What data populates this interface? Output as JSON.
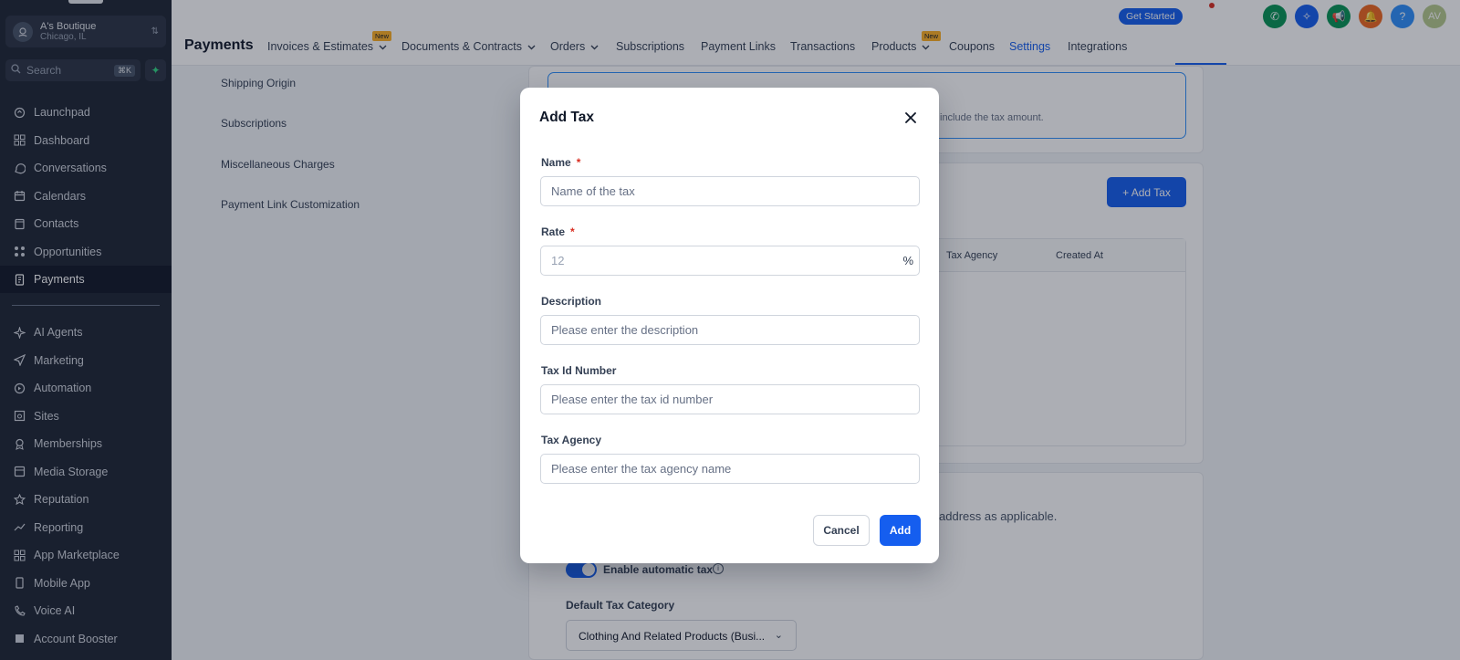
{
  "account": {
    "name": "A's Boutique",
    "location": "Chicago, IL"
  },
  "search": {
    "placeholder": "Search",
    "shortcut": "⌘K"
  },
  "sidebar": {
    "top_items": [
      {
        "label": "Launchpad",
        "icon": "rocket-icon"
      },
      {
        "label": "Dashboard",
        "icon": "grid-icon"
      },
      {
        "label": "Conversations",
        "icon": "chat-icon"
      },
      {
        "label": "Calendars",
        "icon": "calendar-icon"
      },
      {
        "label": "Contacts",
        "icon": "contacts-icon"
      },
      {
        "label": "Opportunities",
        "icon": "opportunities-icon"
      },
      {
        "label": "Payments",
        "icon": "payments-icon",
        "active": true
      }
    ],
    "bottom_items": [
      {
        "label": "AI Agents",
        "icon": "sparkle-icon"
      },
      {
        "label": "Marketing",
        "icon": "send-icon"
      },
      {
        "label": "Automation",
        "icon": "automation-icon"
      },
      {
        "label": "Sites",
        "icon": "sites-icon"
      },
      {
        "label": "Memberships",
        "icon": "membership-icon"
      },
      {
        "label": "Media Storage",
        "icon": "media-icon"
      },
      {
        "label": "Reputation",
        "icon": "star-icon"
      },
      {
        "label": "Reporting",
        "icon": "trend-icon"
      },
      {
        "label": "App Marketplace",
        "icon": "apps-icon"
      },
      {
        "label": "Mobile App",
        "icon": "mobile-icon"
      },
      {
        "label": "Voice AI",
        "icon": "phone-icon"
      },
      {
        "label": "Account Booster",
        "icon": "booster-icon"
      }
    ]
  },
  "header": {
    "title": "Payments",
    "get_started": "Get Started",
    "new_badge": "New",
    "avatar_initials": "AV",
    "help_glyph": "?",
    "tabs": [
      {
        "label": "Invoices & Estimates",
        "dropdown": true,
        "badge": "New"
      },
      {
        "label": "Documents & Contracts",
        "dropdown": true
      },
      {
        "label": "Orders",
        "dropdown": true
      },
      {
        "label": "Subscriptions"
      },
      {
        "label": "Payment Links"
      },
      {
        "label": "Transactions"
      },
      {
        "label": "Products",
        "dropdown": true,
        "badge": "New"
      },
      {
        "label": "Coupons"
      },
      {
        "label": "Settings",
        "selected": true
      },
      {
        "label": "Integrations"
      }
    ]
  },
  "settings_nav": [
    "Shipping Origin",
    "Subscriptions",
    "Miscellaneous Charges",
    "Payment Link Customization"
  ],
  "background": {
    "tax_hint": "include the tax amount.",
    "add_tax_button": "+ Add Tax",
    "table_headers": [
      "Tax Agency",
      "Created At"
    ],
    "address_text": "address as applicable.",
    "auto_tax_label": "Enable automatic tax",
    "default_category_label": "Default Tax Category",
    "default_category_value": "Clothing And Related Products (Busi..."
  },
  "modal": {
    "title": "Add Tax",
    "fields": {
      "name": {
        "label": "Name",
        "required": "*",
        "placeholder": "Name of the tax",
        "value": ""
      },
      "rate": {
        "label": "Rate",
        "required": "*",
        "placeholder": "12",
        "suffix": "%",
        "value": ""
      },
      "description": {
        "label": "Description",
        "placeholder": "Please enter the description",
        "value": ""
      },
      "tax_id": {
        "label": "Tax Id Number",
        "placeholder": "Please enter the tax id number",
        "value": ""
      },
      "tax_agency": {
        "label": "Tax Agency",
        "placeholder": "Please enter the tax agency name",
        "value": ""
      }
    },
    "cancel_label": "Cancel",
    "add_label": "Add"
  },
  "colors": {
    "primary": "#155eef",
    "sidebar_bg": "#1e2533",
    "required": "#d92d20"
  }
}
